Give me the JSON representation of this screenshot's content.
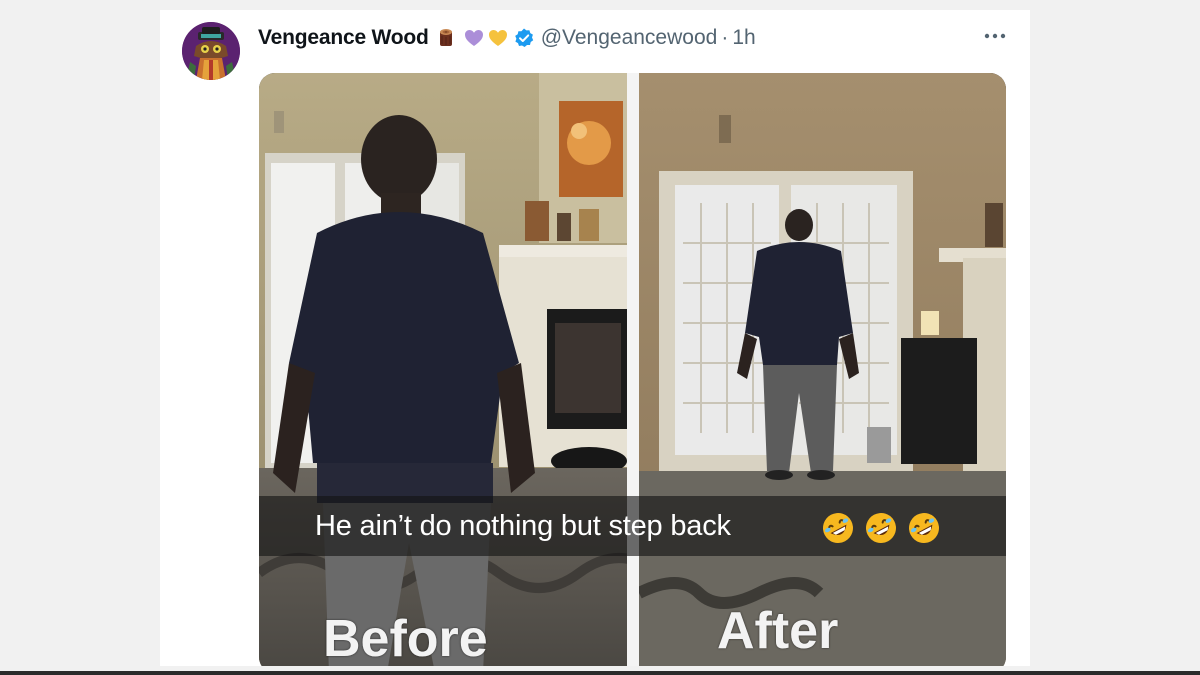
{
  "tweet": {
    "author": {
      "display_name": "Vengeance Wood",
      "handle": "@Vengeancewood",
      "name_emojis": [
        "wood-log-icon",
        "purple-heart-icon",
        "yellow-heart-icon"
      ],
      "verified": true
    },
    "separator": "·",
    "time": "1h",
    "more_icon": "more-horizontal-icon",
    "media": {
      "caption": "He ain’t do nothing but step back",
      "caption_emojis": [
        "rolling-on-floor-laughing-icon",
        "rolling-on-floor-laughing-icon",
        "rolling-on-floor-laughing-icon"
      ],
      "left_label": "Before",
      "right_label": "After"
    }
  },
  "colors": {
    "name": "#0f1419",
    "secondary": "#536471",
    "verified": "#1d9bf0",
    "card_bg": "#ffffff",
    "page_bg": "#f1f1f1"
  }
}
